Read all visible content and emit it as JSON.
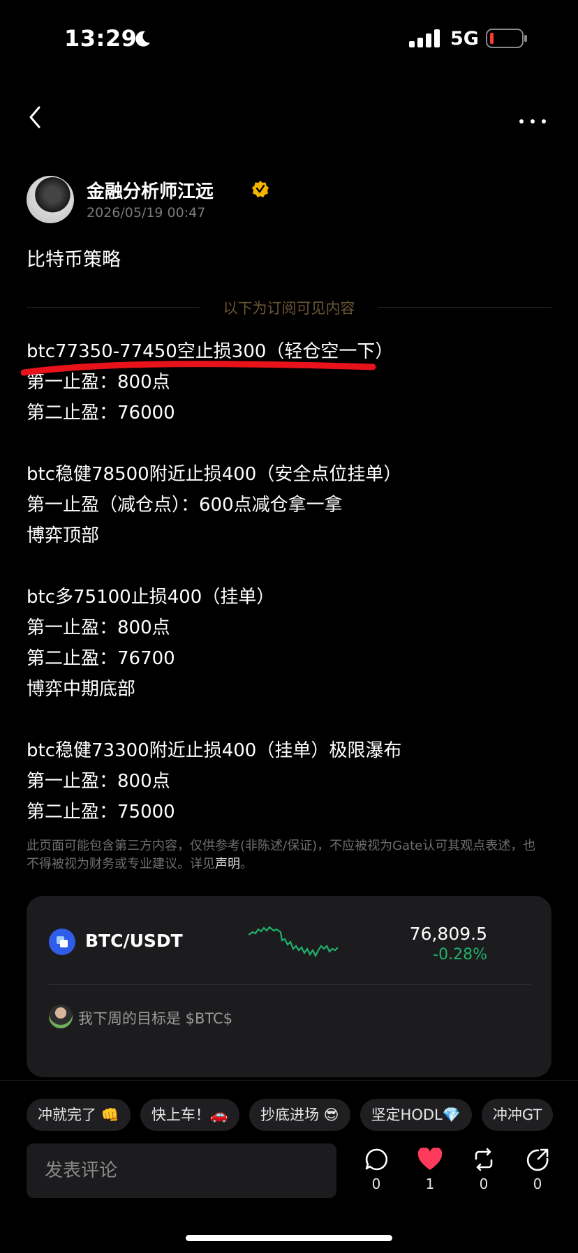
{
  "status_bar": {
    "time": "13:29",
    "network": "5G",
    "icons": [
      "moon-icon",
      "signal-icon",
      "battery-low-icon"
    ],
    "battery_color": "#ff3b30"
  },
  "nav": {
    "icons": [
      "back-arrow-icon",
      "more-dots-icon"
    ]
  },
  "post": {
    "author_name": "金融分析师江远",
    "verified_badge_color": "#f4b400",
    "timestamp": "2026/05/19 00:47",
    "title": "比特币策略",
    "subscriber_divider": "以下为订阅可见内容",
    "lines": [
      "btc77350-77450空止损300（轻仓空一下）",
      "第一止盈：800点",
      "第二止盈：76000",
      "",
      "btc稳健78500附近止损400（安全点位挂单）",
      "第一止盈（减仓点）：600点减仓拿一拿",
      "博弈顶部",
      "",
      "btc多75100止损400（挂单）",
      "第一止盈：800点",
      "第二止盈：76700",
      "博弈中期底部",
      "",
      "btc稳健73300附近止损400（挂单）极限瀑布",
      "第一止盈：800点",
      "第二止盈：75000"
    ],
    "disclaimer": "此页面可能包含第三方内容，仅供参考(非陈述/保证)，不应被视为Gate认可其观点表述，也不得被视为财务或专业建议。详见",
    "disclaimer_link": "声明",
    "disclaimer_end": "。"
  },
  "ticker": {
    "pair": "BTC/USDT",
    "price": "76,809.5",
    "change": "-0.28%",
    "change_color": "#20b26c",
    "related_post": "我下周的目标是 $BTC$"
  },
  "quick_replies": [
    "冲就完了 👊",
    "快上车！🚗",
    "抄底进场 😎",
    "坚定HODL💎",
    "冲冲GT"
  ],
  "actions": {
    "comment_placeholder": "发表评论",
    "comment_count": "0",
    "like_count": "1",
    "like_color": "#ff3b5c",
    "repost_count": "0",
    "share_count": "0"
  }
}
